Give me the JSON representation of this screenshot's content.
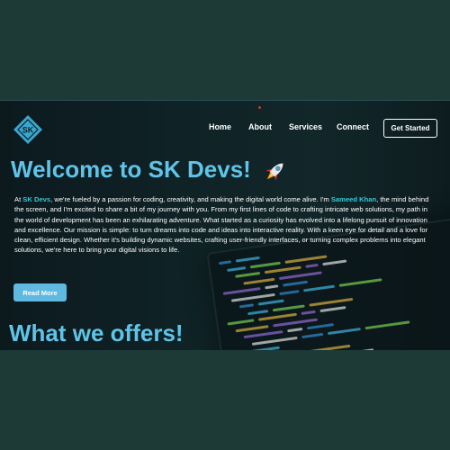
{
  "nav": {
    "logo_icon": "sk-diamond-logo-icon",
    "links": [
      "Home",
      "About",
      "Services",
      "Connect"
    ],
    "cta_label": "Get Started"
  },
  "hero": {
    "title_prefix": "Welcome to",
    "title_brand": "SK Devs!",
    "title_icon": "rocket-icon",
    "intro_parts": {
      "p1": "At ",
      "brand": "SK Devs",
      "p2": ", we're fueled by a passion for coding, creativity, and making the digital world come alive. I'm ",
      "name": "Sameed Khan",
      "p3": ", the mind behind the screen, and I'm excited to share a bit of my journey with you. From my first lines of code to crafting intricate web solutions, my path in the world of development has been an exhilarating adventure. What started as a curiosity has evolved into a lifelong pursuit of innovation and excellence. Our mission is simple: to turn dreams into code and ideas into interactive reality. With a keen eye for detail and a love for clean, efficient design. Whether it's building dynamic websites, crafting user-friendly interfaces, or turning complex problems into elegant solutions, we're here to bring your digital visions to life."
    },
    "read_more_label": "Read More"
  },
  "offers": {
    "title": "What we offers!"
  },
  "colors": {
    "accent": "#5fc4e8",
    "highlight": "#36c9d8",
    "page_bg": "#1d3a37",
    "hero_bg": "#0f2226"
  }
}
